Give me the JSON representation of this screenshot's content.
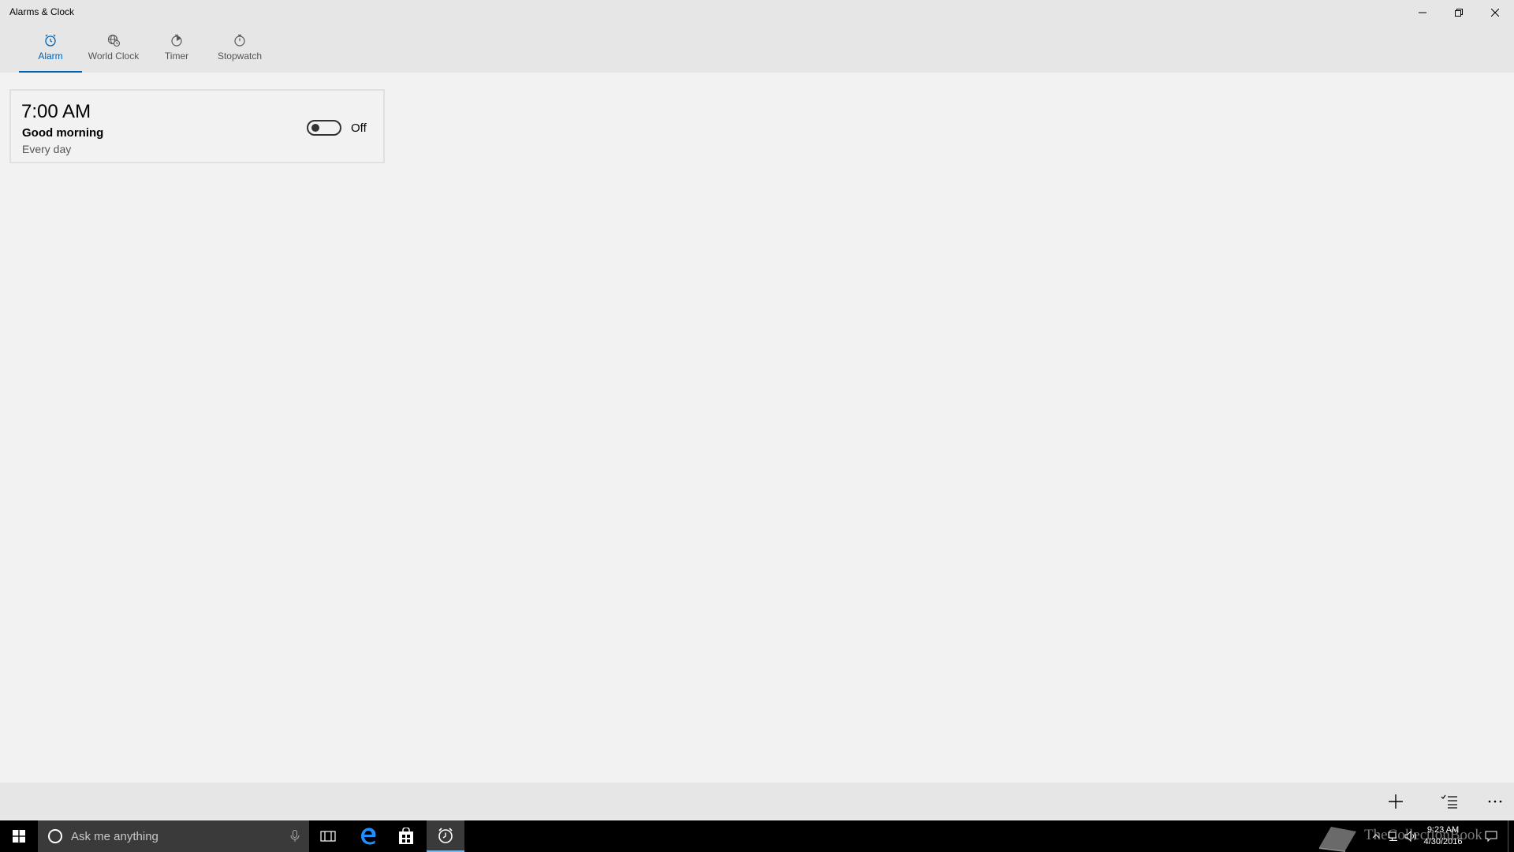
{
  "window": {
    "title": "Alarms & Clock"
  },
  "tabs": [
    {
      "label": "Alarm",
      "icon": "alarm-clock-icon",
      "active": true
    },
    {
      "label": "World Clock",
      "icon": "globe-clock-icon",
      "active": false
    },
    {
      "label": "Timer",
      "icon": "timer-icon",
      "active": false
    },
    {
      "label": "Stopwatch",
      "icon": "stopwatch-icon",
      "active": false
    }
  ],
  "alarms": [
    {
      "time": "7:00 AM",
      "name": "Good morning",
      "repeat": "Every day",
      "toggle_state": "Off"
    }
  ],
  "command_bar": {
    "icons": [
      "plus-icon",
      "select-list-icon",
      "more-icon"
    ]
  },
  "taskbar": {
    "search_placeholder": "Ask me anything",
    "time": "9:23 AM",
    "date": "4/30/2016",
    "watermark": "TheCollectionBook"
  },
  "colors": {
    "accent": "#0063b1",
    "chrome": "#e6e6e6",
    "background": "#f2f2f2",
    "taskbar": "#000000"
  }
}
